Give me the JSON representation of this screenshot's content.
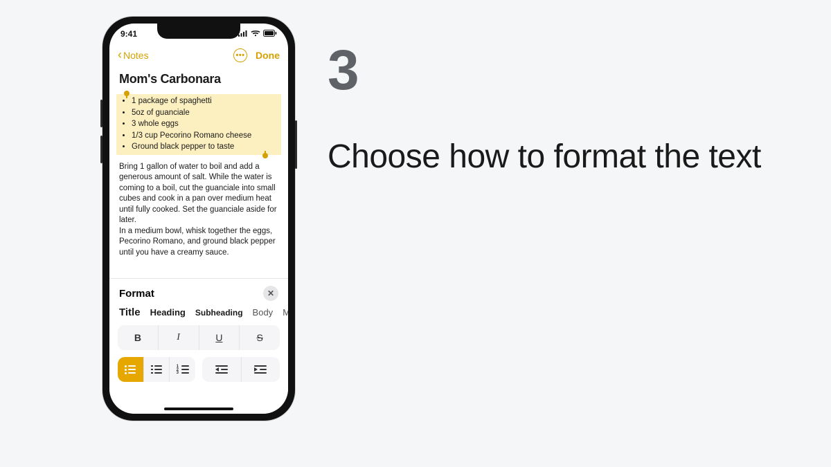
{
  "instruction": {
    "step_number": "3",
    "step_text": "Choose how to format the text"
  },
  "statusbar": {
    "time": "9:41"
  },
  "navbar": {
    "back_label": "Notes",
    "more_symbol": "•••",
    "done_label": "Done"
  },
  "note": {
    "title": "Mom's Carbonara",
    "ingredients": [
      "1 package of spaghetti",
      "5oz of guanciale",
      "3 whole eggs",
      "1/3 cup Pecorino Romano cheese",
      "Ground black pepper to taste"
    ],
    "paragraphs": [
      "Bring 1 gallon of water to boil and add a generous amount of salt. While the water is coming to a boil, cut the guanciale into small cubes and cook in a pan over medium heat until fully cooked. Set the guanciale aside for later.",
      "In a medium bowl, whisk together the eggs, Pecorino Romano, and ground black pepper until you have a creamy sauce."
    ]
  },
  "format_panel": {
    "header": "Format",
    "close_symbol": "✕",
    "styles": {
      "title": "Title",
      "heading": "Heading",
      "subheading": "Subheading",
      "body": "Body",
      "more": "M"
    },
    "text_styles": {
      "bold": "B",
      "italic": "I",
      "underline": "U",
      "strike": "S"
    },
    "num_labels": {
      "one": "1",
      "two": "2",
      "three": "3"
    }
  },
  "colors": {
    "accent": "#d6a100"
  }
}
